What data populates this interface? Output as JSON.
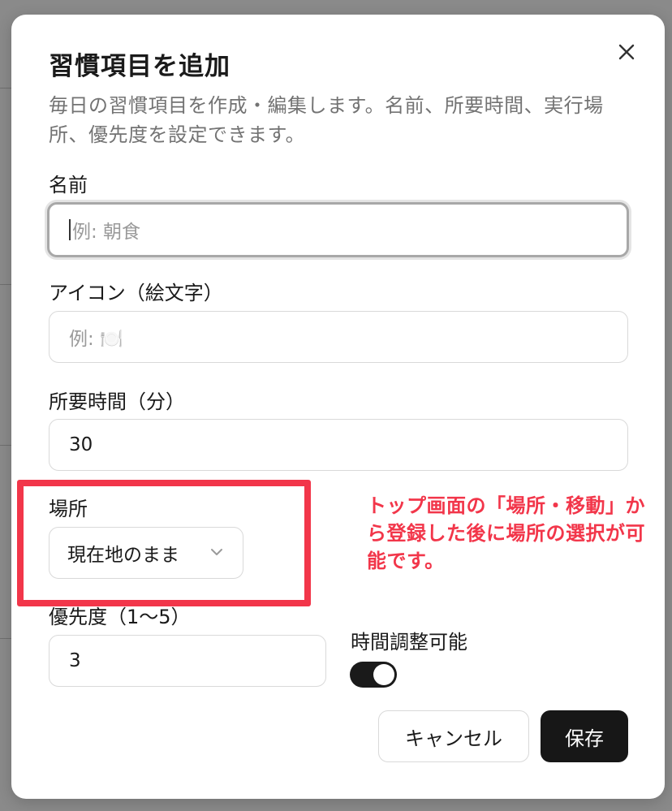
{
  "dialog": {
    "title": "習慣項目を追加",
    "description": "毎日の習慣項目を作成・編集します。名前、所要時間、実行場所、優先度を設定できます。",
    "close_icon": "close-icon"
  },
  "fields": {
    "name": {
      "label": "名前",
      "placeholder": "例: 朝食",
      "value": ""
    },
    "icon": {
      "label": "アイコン（絵文字）",
      "placeholder": "例: 🍽️",
      "value": ""
    },
    "duration": {
      "label": "所要時間（分）",
      "value": "30"
    },
    "location": {
      "label": "場所",
      "selected": "現在地のまま"
    },
    "priority": {
      "label": "優先度（1〜5）",
      "value": "3"
    },
    "adjustable": {
      "label": "時間調整可能",
      "enabled": true
    }
  },
  "annotation": {
    "text": "トップ画面の「場所・移動」から登録した後に場所の選択が可能です。",
    "color": "#f2364a"
  },
  "buttons": {
    "cancel": "キャンセル",
    "save": "保存"
  }
}
